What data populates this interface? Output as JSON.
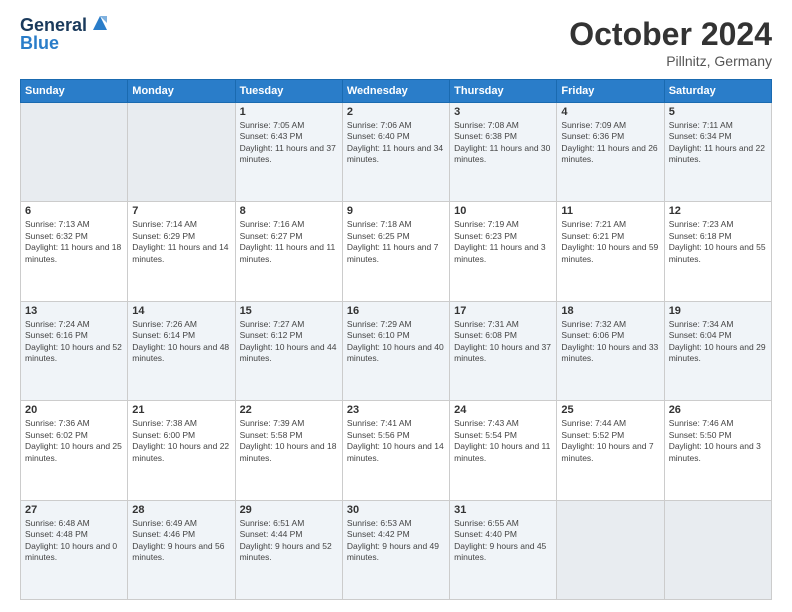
{
  "logo": {
    "line1": "General",
    "line2": "Blue"
  },
  "title": "October 2024",
  "location": "Pillnitz, Germany",
  "weekdays": [
    "Sunday",
    "Monday",
    "Tuesday",
    "Wednesday",
    "Thursday",
    "Friday",
    "Saturday"
  ],
  "weeks": [
    [
      {
        "day": "",
        "sunrise": "",
        "sunset": "",
        "daylight": ""
      },
      {
        "day": "",
        "sunrise": "",
        "sunset": "",
        "daylight": ""
      },
      {
        "day": "1",
        "sunrise": "Sunrise: 7:05 AM",
        "sunset": "Sunset: 6:43 PM",
        "daylight": "Daylight: 11 hours and 37 minutes."
      },
      {
        "day": "2",
        "sunrise": "Sunrise: 7:06 AM",
        "sunset": "Sunset: 6:40 PM",
        "daylight": "Daylight: 11 hours and 34 minutes."
      },
      {
        "day": "3",
        "sunrise": "Sunrise: 7:08 AM",
        "sunset": "Sunset: 6:38 PM",
        "daylight": "Daylight: 11 hours and 30 minutes."
      },
      {
        "day": "4",
        "sunrise": "Sunrise: 7:09 AM",
        "sunset": "Sunset: 6:36 PM",
        "daylight": "Daylight: 11 hours and 26 minutes."
      },
      {
        "day": "5",
        "sunrise": "Sunrise: 7:11 AM",
        "sunset": "Sunset: 6:34 PM",
        "daylight": "Daylight: 11 hours and 22 minutes."
      }
    ],
    [
      {
        "day": "6",
        "sunrise": "Sunrise: 7:13 AM",
        "sunset": "Sunset: 6:32 PM",
        "daylight": "Daylight: 11 hours and 18 minutes."
      },
      {
        "day": "7",
        "sunrise": "Sunrise: 7:14 AM",
        "sunset": "Sunset: 6:29 PM",
        "daylight": "Daylight: 11 hours and 14 minutes."
      },
      {
        "day": "8",
        "sunrise": "Sunrise: 7:16 AM",
        "sunset": "Sunset: 6:27 PM",
        "daylight": "Daylight: 11 hours and 11 minutes."
      },
      {
        "day": "9",
        "sunrise": "Sunrise: 7:18 AM",
        "sunset": "Sunset: 6:25 PM",
        "daylight": "Daylight: 11 hours and 7 minutes."
      },
      {
        "day": "10",
        "sunrise": "Sunrise: 7:19 AM",
        "sunset": "Sunset: 6:23 PM",
        "daylight": "Daylight: 11 hours and 3 minutes."
      },
      {
        "day": "11",
        "sunrise": "Sunrise: 7:21 AM",
        "sunset": "Sunset: 6:21 PM",
        "daylight": "Daylight: 10 hours and 59 minutes."
      },
      {
        "day": "12",
        "sunrise": "Sunrise: 7:23 AM",
        "sunset": "Sunset: 6:18 PM",
        "daylight": "Daylight: 10 hours and 55 minutes."
      }
    ],
    [
      {
        "day": "13",
        "sunrise": "Sunrise: 7:24 AM",
        "sunset": "Sunset: 6:16 PM",
        "daylight": "Daylight: 10 hours and 52 minutes."
      },
      {
        "day": "14",
        "sunrise": "Sunrise: 7:26 AM",
        "sunset": "Sunset: 6:14 PM",
        "daylight": "Daylight: 10 hours and 48 minutes."
      },
      {
        "day": "15",
        "sunrise": "Sunrise: 7:27 AM",
        "sunset": "Sunset: 6:12 PM",
        "daylight": "Daylight: 10 hours and 44 minutes."
      },
      {
        "day": "16",
        "sunrise": "Sunrise: 7:29 AM",
        "sunset": "Sunset: 6:10 PM",
        "daylight": "Daylight: 10 hours and 40 minutes."
      },
      {
        "day": "17",
        "sunrise": "Sunrise: 7:31 AM",
        "sunset": "Sunset: 6:08 PM",
        "daylight": "Daylight: 10 hours and 37 minutes."
      },
      {
        "day": "18",
        "sunrise": "Sunrise: 7:32 AM",
        "sunset": "Sunset: 6:06 PM",
        "daylight": "Daylight: 10 hours and 33 minutes."
      },
      {
        "day": "19",
        "sunrise": "Sunrise: 7:34 AM",
        "sunset": "Sunset: 6:04 PM",
        "daylight": "Daylight: 10 hours and 29 minutes."
      }
    ],
    [
      {
        "day": "20",
        "sunrise": "Sunrise: 7:36 AM",
        "sunset": "Sunset: 6:02 PM",
        "daylight": "Daylight: 10 hours and 25 minutes."
      },
      {
        "day": "21",
        "sunrise": "Sunrise: 7:38 AM",
        "sunset": "Sunset: 6:00 PM",
        "daylight": "Daylight: 10 hours and 22 minutes."
      },
      {
        "day": "22",
        "sunrise": "Sunrise: 7:39 AM",
        "sunset": "Sunset: 5:58 PM",
        "daylight": "Daylight: 10 hours and 18 minutes."
      },
      {
        "day": "23",
        "sunrise": "Sunrise: 7:41 AM",
        "sunset": "Sunset: 5:56 PM",
        "daylight": "Daylight: 10 hours and 14 minutes."
      },
      {
        "day": "24",
        "sunrise": "Sunrise: 7:43 AM",
        "sunset": "Sunset: 5:54 PM",
        "daylight": "Daylight: 10 hours and 11 minutes."
      },
      {
        "day": "25",
        "sunrise": "Sunrise: 7:44 AM",
        "sunset": "Sunset: 5:52 PM",
        "daylight": "Daylight: 10 hours and 7 minutes."
      },
      {
        "day": "26",
        "sunrise": "Sunrise: 7:46 AM",
        "sunset": "Sunset: 5:50 PM",
        "daylight": "Daylight: 10 hours and 3 minutes."
      }
    ],
    [
      {
        "day": "27",
        "sunrise": "Sunrise: 6:48 AM",
        "sunset": "Sunset: 4:48 PM",
        "daylight": "Daylight: 10 hours and 0 minutes."
      },
      {
        "day": "28",
        "sunrise": "Sunrise: 6:49 AM",
        "sunset": "Sunset: 4:46 PM",
        "daylight": "Daylight: 9 hours and 56 minutes."
      },
      {
        "day": "29",
        "sunrise": "Sunrise: 6:51 AM",
        "sunset": "Sunset: 4:44 PM",
        "daylight": "Daylight: 9 hours and 52 minutes."
      },
      {
        "day": "30",
        "sunrise": "Sunrise: 6:53 AM",
        "sunset": "Sunset: 4:42 PM",
        "daylight": "Daylight: 9 hours and 49 minutes."
      },
      {
        "day": "31",
        "sunrise": "Sunrise: 6:55 AM",
        "sunset": "Sunset: 4:40 PM",
        "daylight": "Daylight: 9 hours and 45 minutes."
      },
      {
        "day": "",
        "sunrise": "",
        "sunset": "",
        "daylight": ""
      },
      {
        "day": "",
        "sunrise": "",
        "sunset": "",
        "daylight": ""
      }
    ]
  ]
}
